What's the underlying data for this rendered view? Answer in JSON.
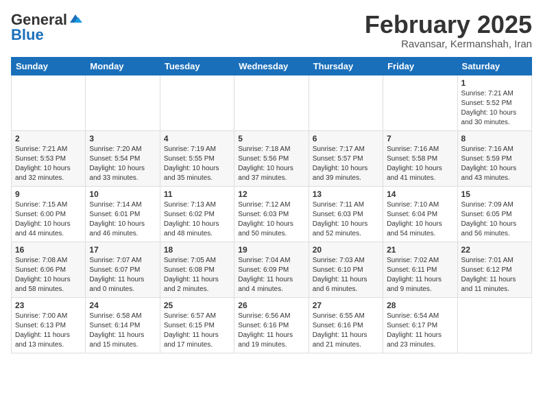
{
  "header": {
    "logo_general": "General",
    "logo_blue": "Blue",
    "month_title": "February 2025",
    "location": "Ravansar, Kermanshah, Iran"
  },
  "weekdays": [
    "Sunday",
    "Monday",
    "Tuesday",
    "Wednesday",
    "Thursday",
    "Friday",
    "Saturday"
  ],
  "weeks": [
    [
      {
        "day": "",
        "info": ""
      },
      {
        "day": "",
        "info": ""
      },
      {
        "day": "",
        "info": ""
      },
      {
        "day": "",
        "info": ""
      },
      {
        "day": "",
        "info": ""
      },
      {
        "day": "",
        "info": ""
      },
      {
        "day": "1",
        "info": "Sunrise: 7:21 AM\nSunset: 5:52 PM\nDaylight: 10 hours\nand 30 minutes."
      }
    ],
    [
      {
        "day": "2",
        "info": "Sunrise: 7:21 AM\nSunset: 5:53 PM\nDaylight: 10 hours\nand 32 minutes."
      },
      {
        "day": "3",
        "info": "Sunrise: 7:20 AM\nSunset: 5:54 PM\nDaylight: 10 hours\nand 33 minutes."
      },
      {
        "day": "4",
        "info": "Sunrise: 7:19 AM\nSunset: 5:55 PM\nDaylight: 10 hours\nand 35 minutes."
      },
      {
        "day": "5",
        "info": "Sunrise: 7:18 AM\nSunset: 5:56 PM\nDaylight: 10 hours\nand 37 minutes."
      },
      {
        "day": "6",
        "info": "Sunrise: 7:17 AM\nSunset: 5:57 PM\nDaylight: 10 hours\nand 39 minutes."
      },
      {
        "day": "7",
        "info": "Sunrise: 7:16 AM\nSunset: 5:58 PM\nDaylight: 10 hours\nand 41 minutes."
      },
      {
        "day": "8",
        "info": "Sunrise: 7:16 AM\nSunset: 5:59 PM\nDaylight: 10 hours\nand 43 minutes."
      }
    ],
    [
      {
        "day": "9",
        "info": "Sunrise: 7:15 AM\nSunset: 6:00 PM\nDaylight: 10 hours\nand 44 minutes."
      },
      {
        "day": "10",
        "info": "Sunrise: 7:14 AM\nSunset: 6:01 PM\nDaylight: 10 hours\nand 46 minutes."
      },
      {
        "day": "11",
        "info": "Sunrise: 7:13 AM\nSunset: 6:02 PM\nDaylight: 10 hours\nand 48 minutes."
      },
      {
        "day": "12",
        "info": "Sunrise: 7:12 AM\nSunset: 6:03 PM\nDaylight: 10 hours\nand 50 minutes."
      },
      {
        "day": "13",
        "info": "Sunrise: 7:11 AM\nSunset: 6:03 PM\nDaylight: 10 hours\nand 52 minutes."
      },
      {
        "day": "14",
        "info": "Sunrise: 7:10 AM\nSunset: 6:04 PM\nDaylight: 10 hours\nand 54 minutes."
      },
      {
        "day": "15",
        "info": "Sunrise: 7:09 AM\nSunset: 6:05 PM\nDaylight: 10 hours\nand 56 minutes."
      }
    ],
    [
      {
        "day": "16",
        "info": "Sunrise: 7:08 AM\nSunset: 6:06 PM\nDaylight: 10 hours\nand 58 minutes."
      },
      {
        "day": "17",
        "info": "Sunrise: 7:07 AM\nSunset: 6:07 PM\nDaylight: 11 hours\nand 0 minutes."
      },
      {
        "day": "18",
        "info": "Sunrise: 7:05 AM\nSunset: 6:08 PM\nDaylight: 11 hours\nand 2 minutes."
      },
      {
        "day": "19",
        "info": "Sunrise: 7:04 AM\nSunset: 6:09 PM\nDaylight: 11 hours\nand 4 minutes."
      },
      {
        "day": "20",
        "info": "Sunrise: 7:03 AM\nSunset: 6:10 PM\nDaylight: 11 hours\nand 6 minutes."
      },
      {
        "day": "21",
        "info": "Sunrise: 7:02 AM\nSunset: 6:11 PM\nDaylight: 11 hours\nand 9 minutes."
      },
      {
        "day": "22",
        "info": "Sunrise: 7:01 AM\nSunset: 6:12 PM\nDaylight: 11 hours\nand 11 minutes."
      }
    ],
    [
      {
        "day": "23",
        "info": "Sunrise: 7:00 AM\nSunset: 6:13 PM\nDaylight: 11 hours\nand 13 minutes."
      },
      {
        "day": "24",
        "info": "Sunrise: 6:58 AM\nSunset: 6:14 PM\nDaylight: 11 hours\nand 15 minutes."
      },
      {
        "day": "25",
        "info": "Sunrise: 6:57 AM\nSunset: 6:15 PM\nDaylight: 11 hours\nand 17 minutes."
      },
      {
        "day": "26",
        "info": "Sunrise: 6:56 AM\nSunset: 6:16 PM\nDaylight: 11 hours\nand 19 minutes."
      },
      {
        "day": "27",
        "info": "Sunrise: 6:55 AM\nSunset: 6:16 PM\nDaylight: 11 hours\nand 21 minutes."
      },
      {
        "day": "28",
        "info": "Sunrise: 6:54 AM\nSunset: 6:17 PM\nDaylight: 11 hours\nand 23 minutes."
      },
      {
        "day": "",
        "info": ""
      }
    ]
  ]
}
